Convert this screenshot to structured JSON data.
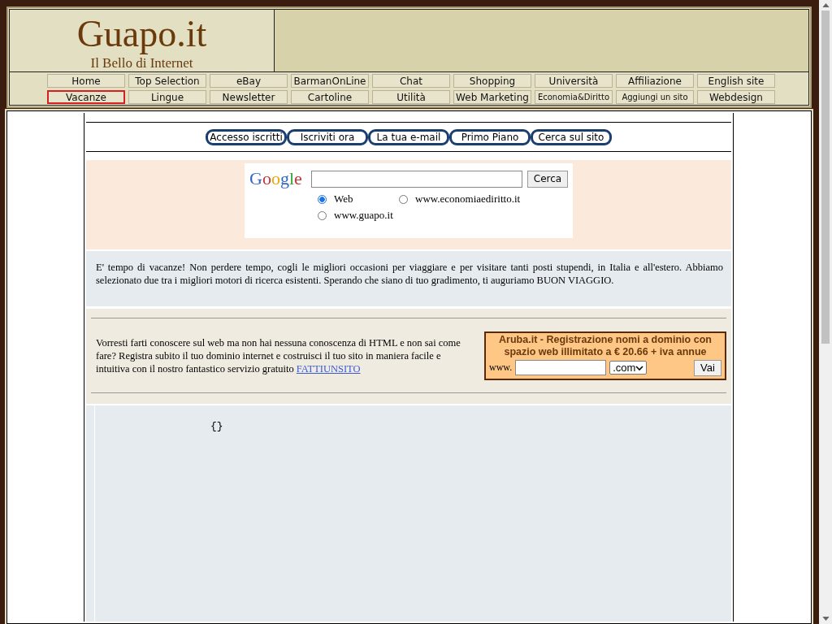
{
  "header": {
    "title": "Guapo.it",
    "tagline": "Il Bello di Internet"
  },
  "nav_rows": [
    [
      {
        "label": "Home",
        "selected": false
      },
      {
        "label": "Top Selection",
        "selected": false
      },
      {
        "label": "eBay",
        "selected": false
      },
      {
        "label": "BarmanOnLine",
        "selected": false
      },
      {
        "label": "Chat",
        "selected": false
      },
      {
        "label": "Shopping",
        "selected": false
      },
      {
        "label": "Università",
        "selected": false
      },
      {
        "label": "Affiliazione",
        "selected": false
      },
      {
        "label": "English site",
        "selected": false
      }
    ],
    [
      {
        "label": "Vacanze",
        "selected": true
      },
      {
        "label": "Lingue",
        "selected": false
      },
      {
        "label": "Newsletter",
        "selected": false
      },
      {
        "label": "Cartoline",
        "selected": false
      },
      {
        "label": "Utilità",
        "selected": false
      },
      {
        "label": "Web Marketing",
        "selected": false
      },
      {
        "label": "Economia&Diritto",
        "selected": false
      },
      {
        "label": "Aggiungi un sito",
        "selected": false
      },
      {
        "label": "Webdesign",
        "selected": false
      }
    ]
  ],
  "top_links": [
    "Accesso iscritti",
    "Iscriviti ora",
    "La tua e-mail",
    "Primo Piano",
    "Cerca sul sito"
  ],
  "search": {
    "logo": "Google",
    "button": "Cerca",
    "options": [
      {
        "label": "Web",
        "selected": true
      },
      {
        "label": "www.economiaediritto.it",
        "selected": false
      },
      {
        "label": "www.guapo.it",
        "selected": false
      }
    ]
  },
  "intro": "E' tempo di vacanze! Non perdere tempo, cogli le migliori occasioni per viaggiare e per visitare tanti posti stupendi, in Italia e all'estero. Abbiamo selezionato due tra i migliori motori di ricerca esistenti. Sperando che siano di tuo gradimento, ti auguriamo BUON VIAGGIO.",
  "promo": {
    "text": "Vorresti farti conoscere sul web ma non hai nessuna conoscenza di HTML e non sai come fare? Registra subito il tuo dominio internet e costruisci il tuo sito in maniera facile e intuitiva con il nostro fantastico servizio gratuito",
    "link": "FATTIUNSITO"
  },
  "domain_box": {
    "title": "Aruba.it - Registrazione nomi a dominio con spazio web illimitato a € 20.66 + iva annue",
    "prefix": "www.",
    "extension": ".com",
    "button": "Vai"
  },
  "code_text": "{}"
}
